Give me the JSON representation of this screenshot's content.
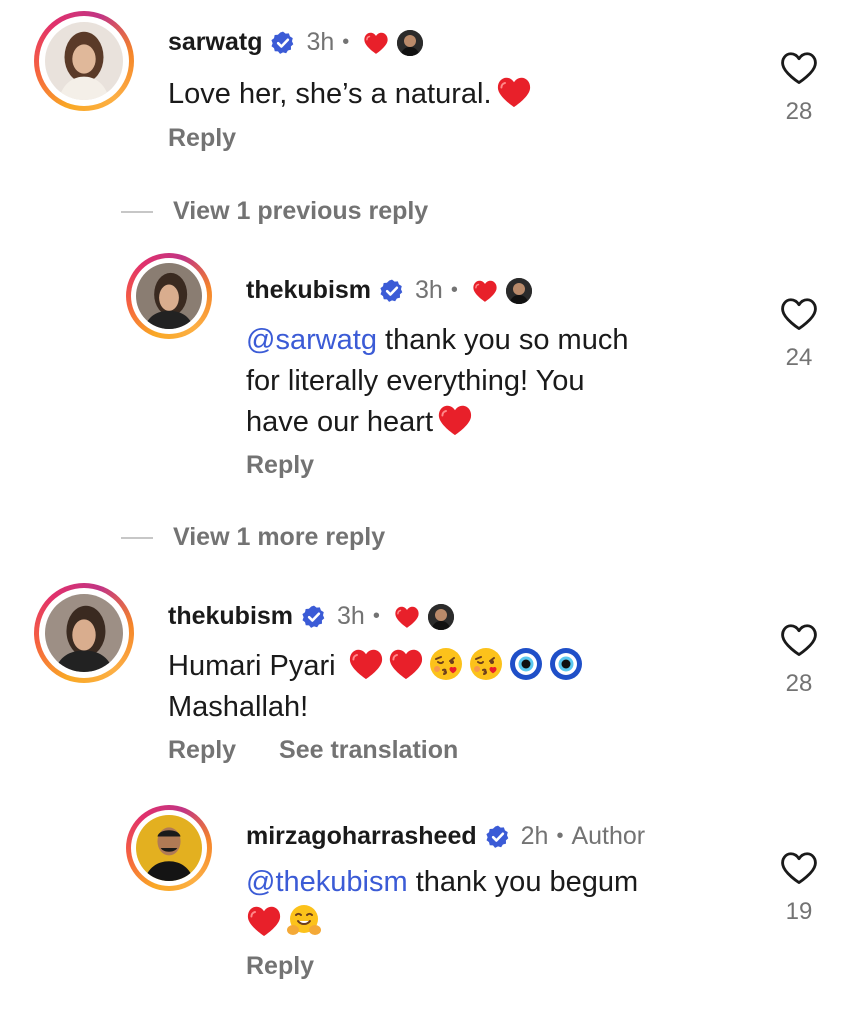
{
  "comments": [
    {
      "username": "sarwatg",
      "time": "3h",
      "dot": "•",
      "text": "Love her, she’s a natural.",
      "reply": "Reply",
      "likes": "28"
    },
    {
      "username": "thekubism",
      "time": "3h",
      "dot": "•",
      "mention": "@sarwatg",
      "text_line1": "thank you so much",
      "text_line2": "for literally everything! You",
      "text_line3": "have our heart",
      "reply": "Reply",
      "likes": "24"
    },
    {
      "username": "thekubism",
      "time": "3h",
      "dot": "•",
      "text_line1": "Humari Pyari",
      "text_line2": "Mashallah!",
      "reply": "Reply",
      "see_translation": "See translation",
      "likes": "28"
    },
    {
      "username": "mirzagoharrasheed",
      "time": "2h",
      "dot": "•",
      "author_tag": "Author",
      "mention": "@thekubism",
      "text_line1": "thank you begum",
      "reply": "Reply",
      "likes": "19"
    }
  ],
  "view_links": {
    "previous": "View 1 previous reply",
    "more": "View 1 more reply"
  },
  "icons": {
    "verified": "verified-badge-icon",
    "like": "heart-outline-icon",
    "heart_emoji": "red-heart-emoji",
    "kiss_emoji": "face-blowing-kiss-emoji",
    "evil_eye_emoji": "nazar-amulet-emoji",
    "hug_emoji": "hugging-face-emoji"
  },
  "colors": {
    "verified": "#3b5bd6",
    "heart": "#e8202a",
    "secondary_text": "#737373",
    "mention": "#3b5bd6"
  }
}
